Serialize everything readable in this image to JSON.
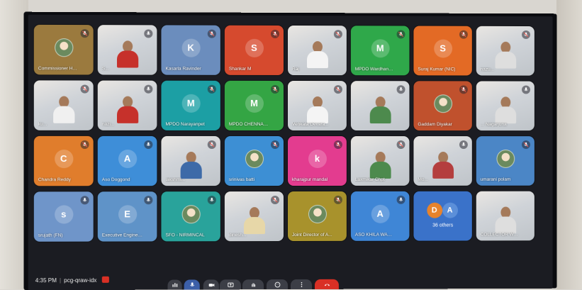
{
  "bottom_bar": {
    "time": "4:35 PM",
    "meeting_code": "pcg-qraw-idx"
  },
  "tiles": [
    {
      "name": "Commissioner Har...",
      "initial": "",
      "bg": "#9b7a3e",
      "mode": "photo",
      "mic": "muted"
    },
    {
      "name": "S...",
      "initial": "",
      "bg": "",
      "mode": "video",
      "mic": "off"
    },
    {
      "name": "Kasarla Ravinder",
      "initial": "K",
      "bg": "#6b8dbd",
      "mode": "avatar",
      "mic": "muted"
    },
    {
      "name": "Shankar M",
      "initial": "S",
      "bg": "#d64a2e",
      "mode": "avatar",
      "mic": "muted"
    },
    {
      "name": "Raj",
      "initial": "",
      "bg": "",
      "mode": "video",
      "mic": "muted"
    },
    {
      "name": "MPDO Wardhanne...",
      "initial": "M",
      "bg": "#2fa84a",
      "mode": "avatar",
      "mic": "muted"
    },
    {
      "name": "Suraj Kumar (NIC)",
      "initial": "S",
      "bg": "#e36a25",
      "mode": "avatar",
      "mic": "muted"
    },
    {
      "name": "nazu...",
      "initial": "",
      "bg": "",
      "mode": "video",
      "mic": "muted"
    },
    {
      "name": "ku...",
      "initial": "",
      "bg": "",
      "mode": "video",
      "mic": "muted"
    },
    {
      "name": "nazi...",
      "initial": "",
      "bg": "",
      "mode": "video",
      "mic": "off"
    },
    {
      "name": "MPDO Narayanpet",
      "initial": "M",
      "bg": "#1c9fa4",
      "mode": "avatar",
      "mic": "muted"
    },
    {
      "name": "MPDO CHENNAR...",
      "initial": "M",
      "bg": "#34a544",
      "mode": "avatar",
      "mic": "muted"
    },
    {
      "name": "Venkata Devara...",
      "initial": "",
      "bg": "",
      "mode": "video",
      "mic": "muted"
    },
    {
      "name": "",
      "initial": "",
      "bg": "",
      "mode": "video",
      "mic": "off"
    },
    {
      "name": "Gaddam Diyakar",
      "initial": "",
      "bg": "#c0512d",
      "mode": "photo",
      "mic": "muted"
    },
    {
      "name": "... Nagarjuna",
      "initial": "",
      "bg": "",
      "mode": "video",
      "mic": "off"
    },
    {
      "name": "Chandra Reddy",
      "initial": "C",
      "bg": "#e07d2c",
      "mode": "avatar",
      "mic": "muted"
    },
    {
      "name": "Aso Doggond",
      "initial": "A",
      "bg": "#3e8ed8",
      "mode": "avatar",
      "mic": "off"
    },
    {
      "name": "lakshmi...",
      "initial": "",
      "bg": "",
      "mode": "video",
      "mic": "muted"
    },
    {
      "name": "srinivas batti",
      "initial": "",
      "bg": "#3d8fd4",
      "mode": "photo",
      "mic": "muted"
    },
    {
      "name": "kharajpur mandal",
      "initial": "k",
      "bg": "#e33c8f",
      "mode": "avatar",
      "mic": "muted"
    },
    {
      "name": "Laxmikar Chpt",
      "initial": "",
      "bg": "",
      "mode": "video",
      "mic": "muted"
    },
    {
      "name": "Mo...",
      "initial": "",
      "bg": "",
      "mode": "video",
      "mic": "off"
    },
    {
      "name": "umarani polam",
      "initial": "",
      "bg": "#4b86c6",
      "mode": "photo",
      "mic": "muted"
    },
    {
      "name": "srujath (FN)",
      "initial": "s",
      "bg": "#6f95c9",
      "mode": "avatar",
      "mic": "off"
    },
    {
      "name": "Executive Enginee...",
      "initial": "E",
      "bg": "#5f93c8",
      "mode": "avatar",
      "mic": "off"
    },
    {
      "name": "SFO - NIRMINCAL",
      "initial": "",
      "bg": "#29a39b",
      "mode": "photo",
      "mic": "off"
    },
    {
      "name": "dinesh...",
      "initial": "",
      "bg": "",
      "mode": "video",
      "mic": "muted"
    },
    {
      "name": "Joint Director of A...",
      "initial": "",
      "bg": "#a8922c",
      "mode": "photo",
      "mic": "muted"
    },
    {
      "name": "ASO KHILA WARA...",
      "initial": "A",
      "bg": "#3f86d6",
      "mode": "avatar",
      "mic": "off"
    },
    {
      "name": "",
      "initial": "",
      "bg": "#3a72c9",
      "mode": "others",
      "mic": "none"
    },
    {
      "name": "COLLECTOR WA...",
      "initial": "",
      "bg": "",
      "mode": "video",
      "mic": "none"
    }
  ],
  "others_tile": {
    "label": "36 others",
    "initials": [
      "D",
      "A"
    ],
    "colors": [
      "#e7832c",
      "#5b8fd9"
    ]
  },
  "colors": {
    "screen_bg": "#1b1c22",
    "muted_icon": "#ffffff",
    "leave_button": "#d93025"
  },
  "controls": [
    {
      "icon": "audio-levels-icon"
    },
    {
      "icon": "microphone-icon"
    },
    {
      "icon": "camera-icon"
    },
    {
      "icon": "present-icon"
    },
    {
      "icon": "raise-hand-icon"
    },
    {
      "icon": "emoji-icon"
    },
    {
      "icon": "more-options-icon"
    },
    {
      "icon": "leave-call-icon"
    }
  ]
}
